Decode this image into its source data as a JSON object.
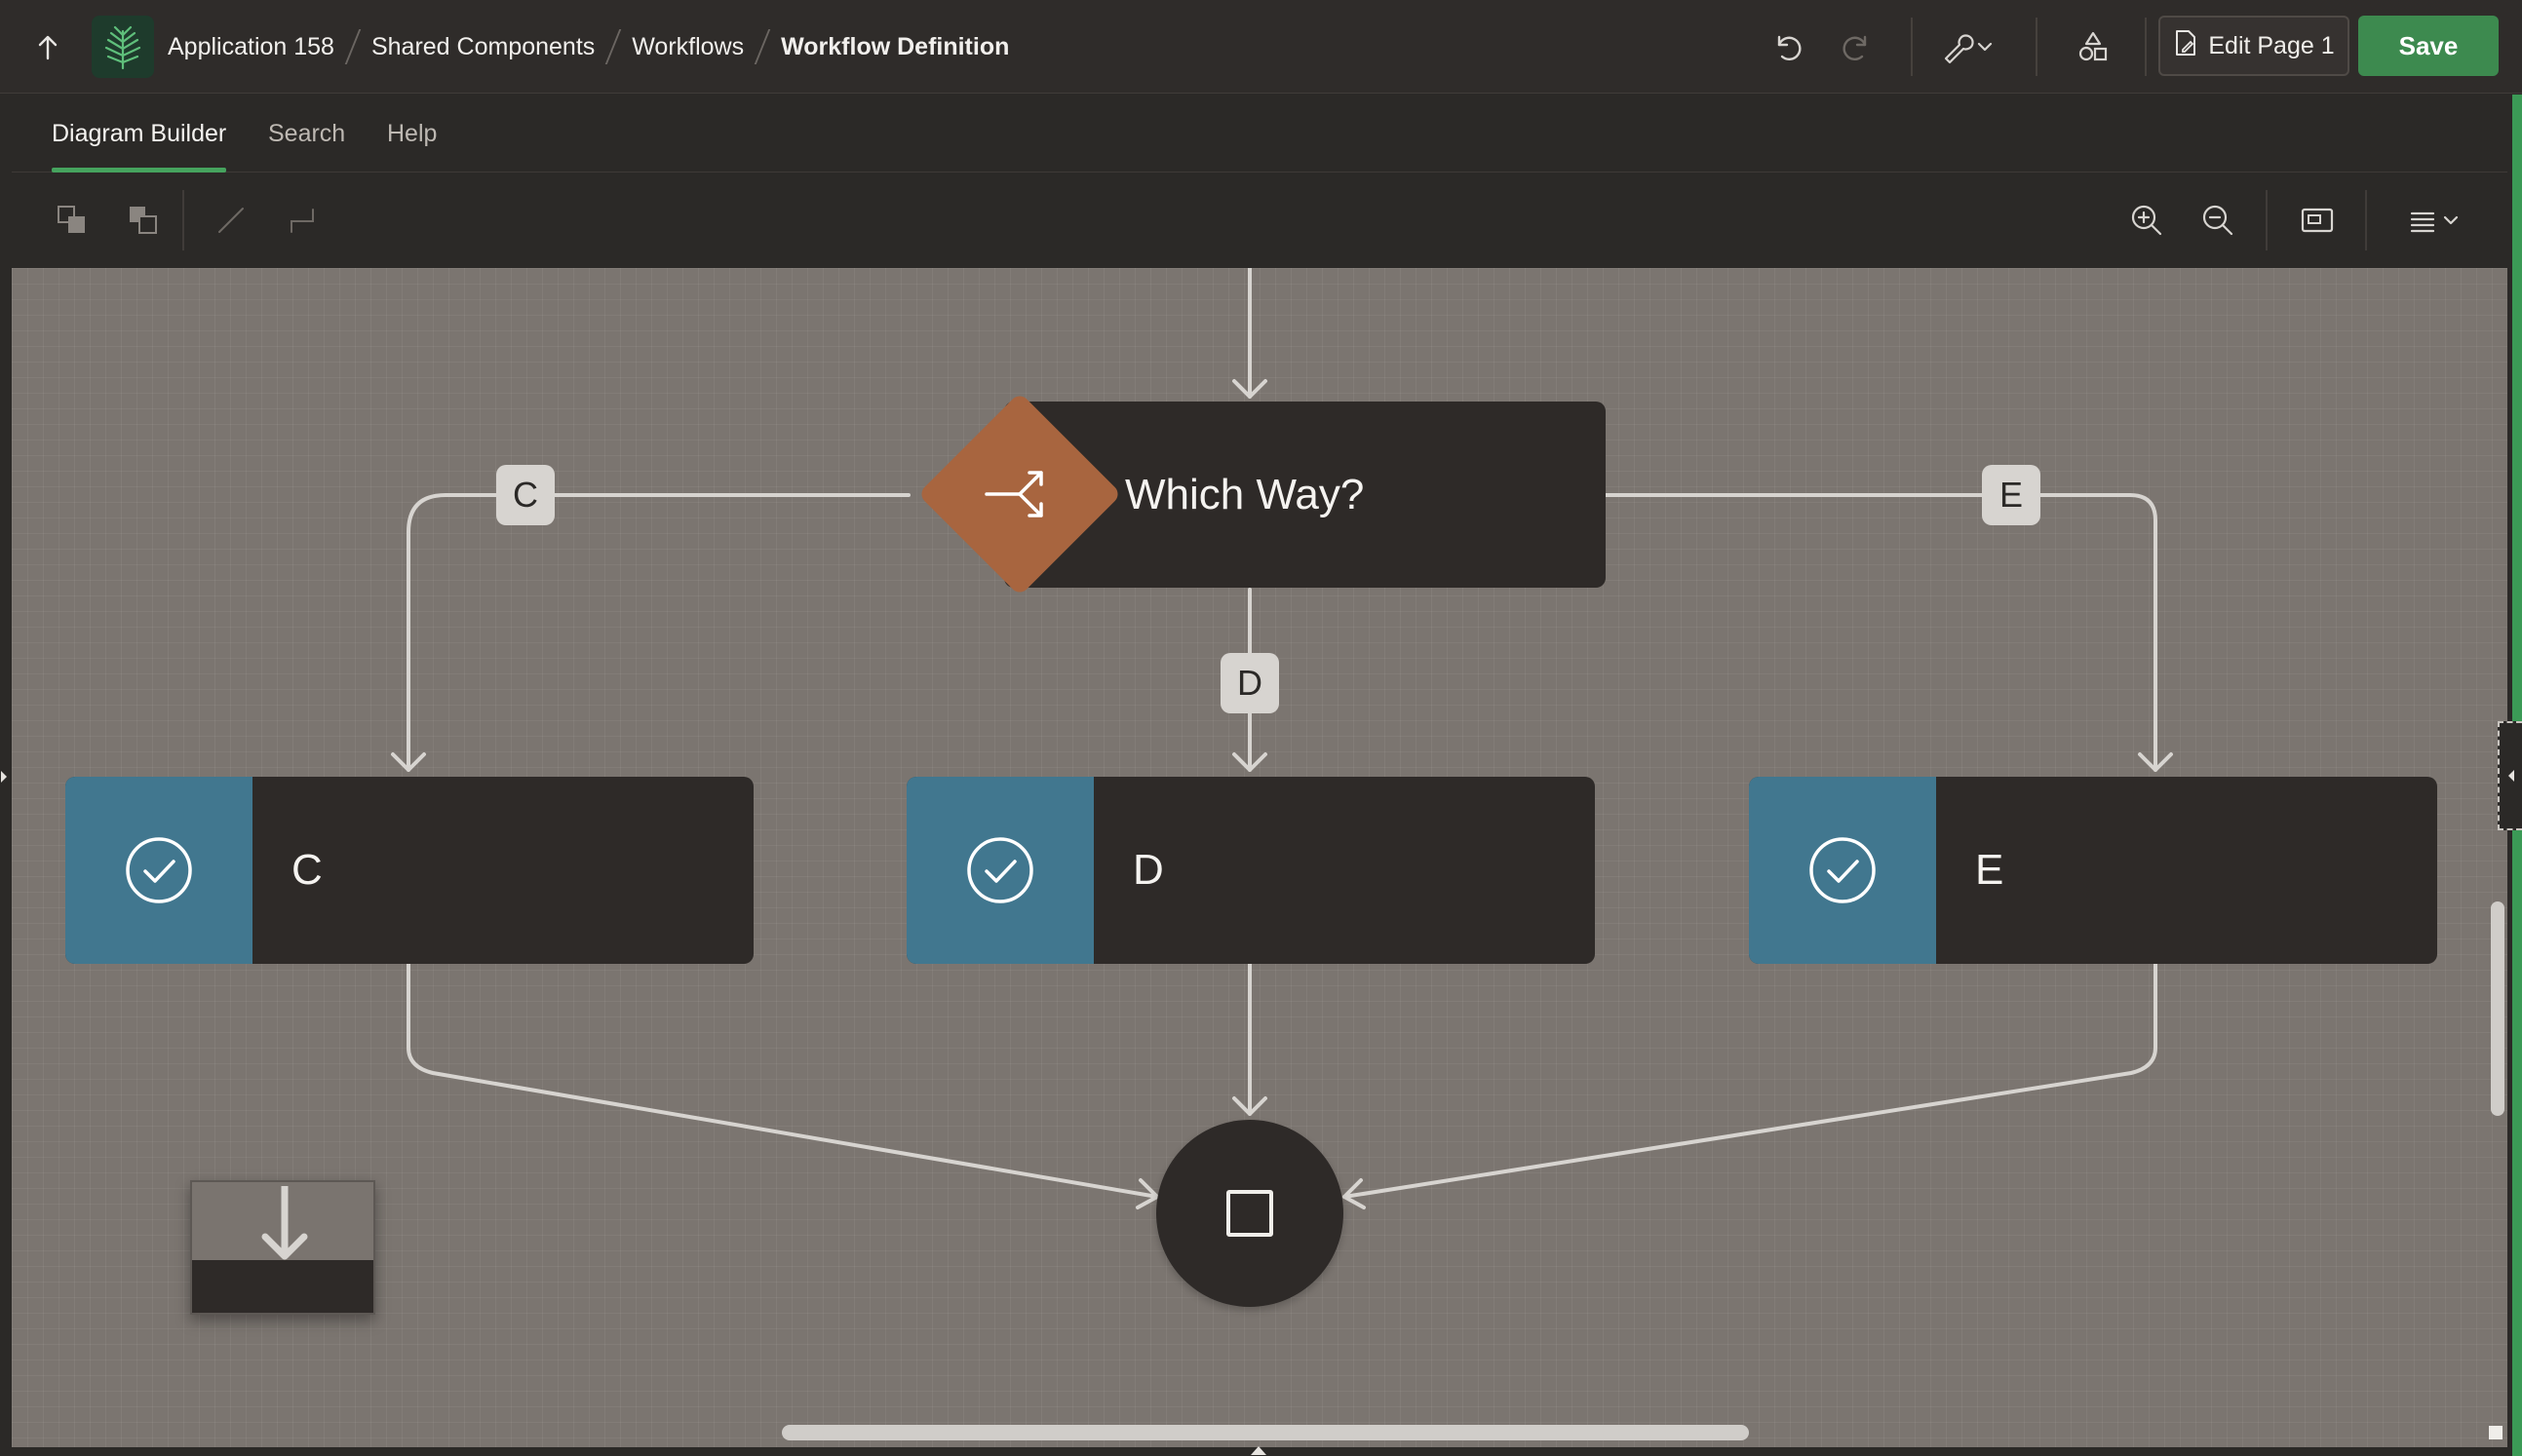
{
  "header": {
    "breadcrumb": [
      {
        "label": "Application 158"
      },
      {
        "label": "Shared Components"
      },
      {
        "label": "Workflows"
      },
      {
        "label": "Workflow Definition"
      }
    ],
    "edit_page_label": "Edit Page 1",
    "save_label": "Save",
    "icons": {
      "up": "arrow-up-icon",
      "logo": "app-logo-icon",
      "undo": "undo-icon",
      "redo": "redo-icon",
      "utilities": "wrench-icon",
      "shared_components": "shapes-icon",
      "edit_page": "page-edit-icon"
    }
  },
  "tabs": [
    {
      "label": "Diagram Builder",
      "active": true
    },
    {
      "label": "Search",
      "active": false
    },
    {
      "label": "Help",
      "active": false
    }
  ],
  "toolbar": {
    "left_tools": [
      "bring-forward-icon",
      "send-backward-icon",
      "straight-connector-icon",
      "orthogonal-connector-icon"
    ],
    "right_tools": [
      "zoom-in-icon",
      "zoom-out-icon",
      "fit-view-icon",
      "menu-icon"
    ]
  },
  "diagram": {
    "decision": {
      "label": "Which Way?",
      "icon": "switch-icon",
      "color": "#a8653f"
    },
    "activities": [
      {
        "label": "C",
        "icon": "check-circle-icon"
      },
      {
        "label": "D",
        "icon": "check-circle-icon"
      },
      {
        "label": "E",
        "icon": "check-circle-icon"
      }
    ],
    "branch_labels": [
      "C",
      "D",
      "E"
    ],
    "end": {
      "icon": "end-square-icon"
    }
  },
  "colors": {
    "save_button": "#3d8a4f",
    "activity_icon_bg": "#41778f",
    "canvas": "#7b7570",
    "accent_green": "#46a35e"
  }
}
